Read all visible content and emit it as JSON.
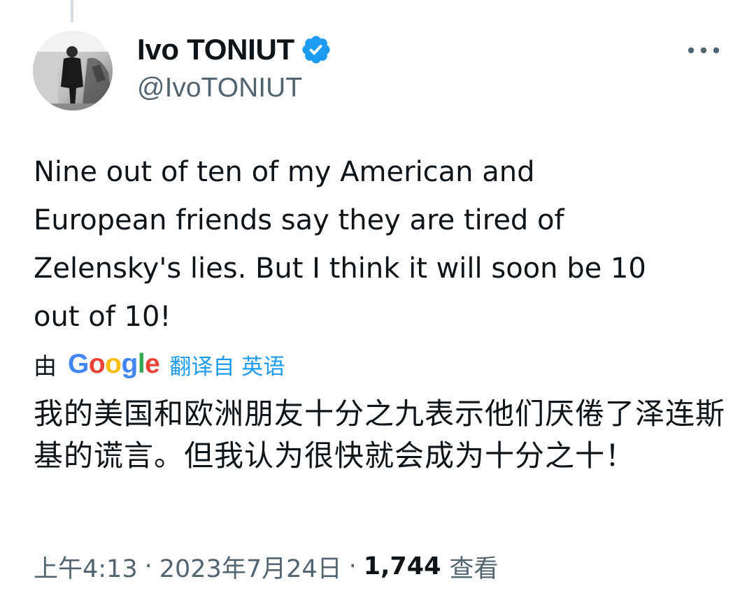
{
  "author": {
    "display_name": "Ivo TONIUT",
    "handle": "@IvoTONIUT",
    "verified": true
  },
  "tweet": {
    "text": "Nine out of ten of my American and\nEuropean friends say they are tired of\nZelensky's lies. But I think it will soon be 10\nout of 10!"
  },
  "translation": {
    "by_label": "由",
    "provider_letters": [
      "G",
      "o",
      "o",
      "g",
      "l",
      "e"
    ],
    "provider_colors": [
      "#4285f4",
      "#ea4335",
      "#fbbc05",
      "#4285f4",
      "#34a853",
      "#ea4335"
    ],
    "link_label": "翻译自 英语",
    "text": "我的美国和欧洲朋友十分之九表示他们厌倦了泽连斯基的谎言。但我认为很快就会成为十分之十！"
  },
  "meta": {
    "time": "上午4:13",
    "separator": "·",
    "date": "2023年7月24日",
    "views": "1,744",
    "views_label": "查看"
  },
  "colors": {
    "accent": "#1d9bf0",
    "secondary_text": "#536471",
    "primary_text": "#0f1419"
  },
  "icons": {
    "verified": "verified-badge-icon",
    "more": "more-options-icon"
  }
}
